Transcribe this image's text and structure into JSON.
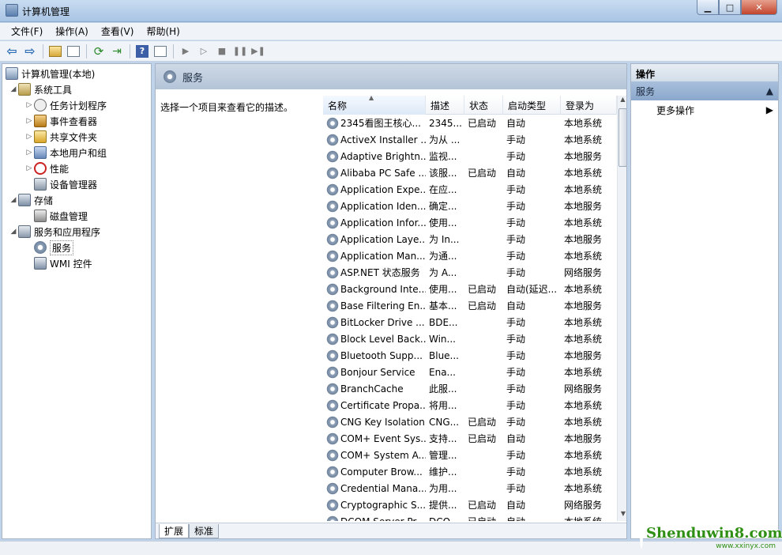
{
  "window": {
    "title": "计算机管理"
  },
  "menu": [
    "文件(F)",
    "操作(A)",
    "查看(V)",
    "帮助(H)"
  ],
  "tree": {
    "root": "计算机管理(本地)",
    "system_tools": "系统工具",
    "task_scheduler": "任务计划程序",
    "event_viewer": "事件查看器",
    "shared_folders": "共享文件夹",
    "local_users": "本地用户和组",
    "performance": "性能",
    "device_manager": "设备管理器",
    "storage": "存储",
    "disk_management": "磁盘管理",
    "services_apps": "服务和应用程序",
    "services": "服务",
    "wmi": "WMI 控件"
  },
  "main": {
    "header": "服务",
    "description_hint": "选择一个项目来查看它的描述。",
    "columns": {
      "name": "名称",
      "desc": "描述",
      "status": "状态",
      "start": "启动类型",
      "logon": "登录为"
    },
    "rows": [
      {
        "name": "2345看图王核心...",
        "desc": "2345...",
        "status": "已启动",
        "start": "自动",
        "logon": "本地系统"
      },
      {
        "name": "ActiveX Installer ...",
        "desc": "为从 ...",
        "status": "",
        "start": "手动",
        "logon": "本地系统"
      },
      {
        "name": "Adaptive Brightn...",
        "desc": "监视...",
        "status": "",
        "start": "手动",
        "logon": "本地服务"
      },
      {
        "name": "Alibaba PC Safe ...",
        "desc": "该服...",
        "status": "已启动",
        "start": "自动",
        "logon": "本地系统"
      },
      {
        "name": "Application Expe...",
        "desc": "在应...",
        "status": "",
        "start": "手动",
        "logon": "本地系统"
      },
      {
        "name": "Application Iden...",
        "desc": "确定...",
        "status": "",
        "start": "手动",
        "logon": "本地服务"
      },
      {
        "name": "Application Infor...",
        "desc": "使用...",
        "status": "",
        "start": "手动",
        "logon": "本地系统"
      },
      {
        "name": "Application Laye...",
        "desc": "为 In...",
        "status": "",
        "start": "手动",
        "logon": "本地服务"
      },
      {
        "name": "Application Man...",
        "desc": "为通...",
        "status": "",
        "start": "手动",
        "logon": "本地系统"
      },
      {
        "name": "ASP.NET 状态服务",
        "desc": "为 A...",
        "status": "",
        "start": "手动",
        "logon": "网络服务"
      },
      {
        "name": "Background Inte...",
        "desc": "使用...",
        "status": "已启动",
        "start": "自动(延迟...",
        "logon": "本地系统"
      },
      {
        "name": "Base Filtering En...",
        "desc": "基本...",
        "status": "已启动",
        "start": "自动",
        "logon": "本地服务"
      },
      {
        "name": "BitLocker Drive ...",
        "desc": "BDE...",
        "status": "",
        "start": "手动",
        "logon": "本地系统"
      },
      {
        "name": "Block Level Back...",
        "desc": "Win...",
        "status": "",
        "start": "手动",
        "logon": "本地系统"
      },
      {
        "name": "Bluetooth Supp...",
        "desc": "Blue...",
        "status": "",
        "start": "手动",
        "logon": "本地服务"
      },
      {
        "name": "Bonjour Service",
        "desc": "Ena...",
        "status": "",
        "start": "手动",
        "logon": "本地系统"
      },
      {
        "name": "BranchCache",
        "desc": "此服...",
        "status": "",
        "start": "手动",
        "logon": "网络服务"
      },
      {
        "name": "Certificate Propa...",
        "desc": "将用...",
        "status": "",
        "start": "手动",
        "logon": "本地系统"
      },
      {
        "name": "CNG Key Isolation",
        "desc": "CNG...",
        "status": "已启动",
        "start": "手动",
        "logon": "本地系统"
      },
      {
        "name": "COM+ Event Sys...",
        "desc": "支持...",
        "status": "已启动",
        "start": "自动",
        "logon": "本地服务"
      },
      {
        "name": "COM+ System A...",
        "desc": "管理...",
        "status": "",
        "start": "手动",
        "logon": "本地系统"
      },
      {
        "name": "Computer Brow...",
        "desc": "维护...",
        "status": "",
        "start": "手动",
        "logon": "本地系统"
      },
      {
        "name": "Credential Mana...",
        "desc": "为用...",
        "status": "",
        "start": "手动",
        "logon": "本地系统"
      },
      {
        "name": "Cryptographic S...",
        "desc": "提供...",
        "status": "已启动",
        "start": "自动",
        "logon": "网络服务"
      },
      {
        "name": "DCOM Server Pr...",
        "desc": "DCO...",
        "status": "已启动",
        "start": "自动",
        "logon": "本地系统"
      }
    ],
    "tabs": [
      "扩展",
      "标准"
    ]
  },
  "actions": {
    "title": "操作",
    "section": "服务",
    "more": "更多操作"
  },
  "watermark": {
    "text": "Shenduwin8.com",
    "url": "www.xxinyx.com"
  }
}
